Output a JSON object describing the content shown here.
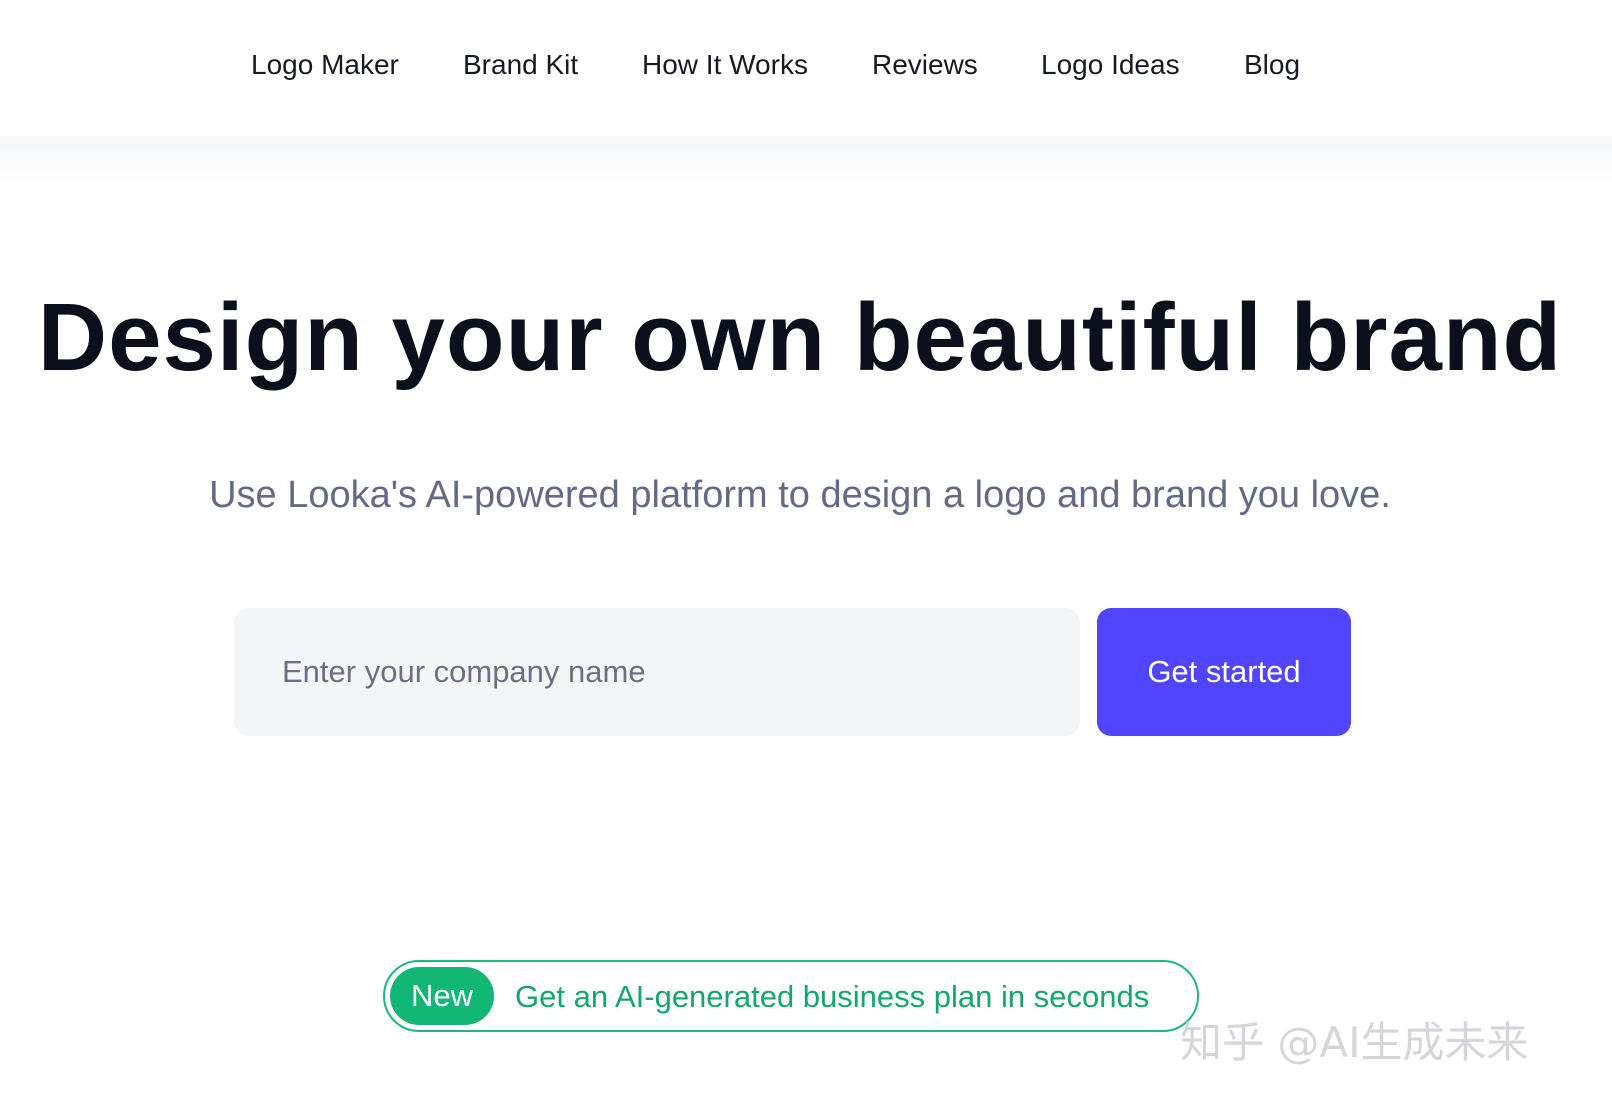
{
  "nav": {
    "items": [
      {
        "label": "Logo Maker"
      },
      {
        "label": "Brand Kit"
      },
      {
        "label": "How It Works"
      },
      {
        "label": "Reviews"
      },
      {
        "label": "Logo Ideas"
      },
      {
        "label": "Blog"
      }
    ]
  },
  "hero": {
    "title": "Design your own beautiful brand",
    "subtitle": "Use Looka's AI-powered platform to design a logo and brand you love."
  },
  "signup": {
    "company_placeholder": "Enter your company name",
    "company_value": "",
    "cta_label": "Get started"
  },
  "announcement": {
    "badge": "New",
    "text": "Get an AI-generated business plan in seconds"
  },
  "watermark": {
    "text": "知乎 @AI生成未来"
  },
  "colors": {
    "accent": "#5145ff",
    "success": "#12b776",
    "heading": "#0c0f1c",
    "muted": "#626a85",
    "input_bg": "#f4f5f7"
  }
}
